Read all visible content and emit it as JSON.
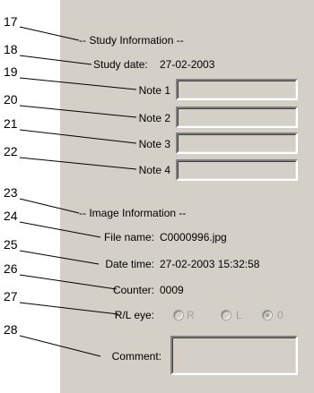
{
  "callouts": [
    "17",
    "18",
    "19",
    "20",
    "21",
    "22",
    "23",
    "24",
    "25",
    "26",
    "27",
    "28"
  ],
  "study": {
    "header": "-- Study Information --",
    "date_label": "Study date:",
    "date_value": "27-02-2003",
    "notes": [
      "Note 1",
      "Note 2",
      "Note 3",
      "Note 4"
    ]
  },
  "image": {
    "header": "-- Image Information --",
    "filename_label": "File name:",
    "filename_value": "C0000996.jpg",
    "datetime_label": "Date time:",
    "datetime_value": "27-02-2003 15:32:58",
    "counter_label": "Counter:",
    "counter_value": "0009",
    "eye_label": "R/L eye:",
    "eye_options": [
      "R",
      "L",
      "0"
    ],
    "eye_selected": "0",
    "comment_label": "Comment:"
  },
  "colors": {
    "panel": "#d4d0c8",
    "disabled_text": "#a0a0a0"
  }
}
